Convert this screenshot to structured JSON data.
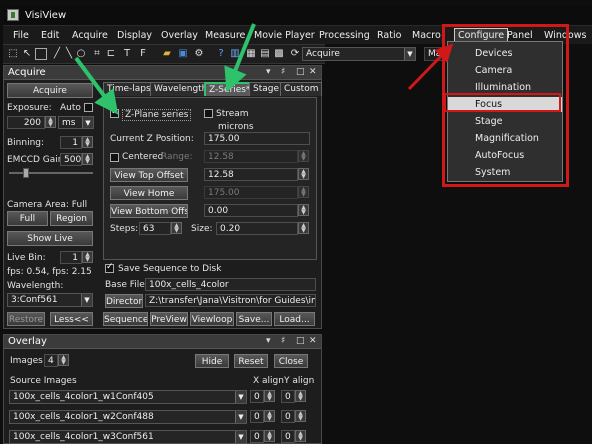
{
  "app": {
    "title": "VisiView"
  },
  "menubar": {
    "items": [
      "File",
      "Edit",
      "Acquire",
      "Display",
      "Overlay",
      "Measure",
      "Movie Player",
      "Processing",
      "Ratio",
      "Macro",
      "Configure",
      "Panel",
      "Windows"
    ]
  },
  "toolbar": {
    "combo_value": "Acquire",
    "combo_right": "Mag"
  },
  "configure_menu": {
    "items": [
      "Devices",
      "Camera",
      "Illumination",
      "Focus",
      "Stage",
      "Magnification",
      "AutoFocus",
      "System"
    ],
    "highlighted": "Focus"
  },
  "acquire_panel": {
    "title": "Acquire",
    "acquire_button": "Acquire",
    "exposure": {
      "label": "Exposure:",
      "auto": "Auto",
      "value": "200",
      "unit": "ms"
    },
    "binning": {
      "label": "Binning:",
      "value": "1"
    },
    "emccd": {
      "label": "EMCCD Gain",
      "value": "500"
    },
    "camera_area": {
      "label": "Camera Area: Full",
      "full": "Full",
      "region": "Region"
    },
    "show_live": "Show Live",
    "live_bin": {
      "label": "Live Bin:",
      "value": "1"
    },
    "fps": "fps: 0.54, fps: 2.15",
    "wavelength": {
      "label": "Wavelength:",
      "value": "3:Conf561"
    },
    "restore": "Restore",
    "less": "Less<<",
    "tabs": [
      "Time-lapse",
      "Wavelength*",
      "Z-Series*",
      "Stage",
      "Custom"
    ],
    "zseries": {
      "zplane_label": "Z-Plane series",
      "zplane_checked": true,
      "stream_label": "Stream",
      "stream_checked": false,
      "microns": "microns",
      "current_z_label": "Current Z Position:",
      "current_z": "175.00",
      "centered_label": "Centered",
      "centered_checked": false,
      "range_label": "Range:",
      "range": "12.58",
      "view_top_offset": "View Top Offset",
      "top_offset": "12.58",
      "view_home": "View Home",
      "home": "175.00",
      "view_bottom_offset": "View Bottom Offset",
      "bottom_offset": "0.00",
      "steps_label": "Steps:",
      "steps": "63",
      "size_label": "Size:",
      "size": "0.20"
    },
    "save_sequence_label": "Save Sequence to Disk",
    "base_file_label": "Base File",
    "base_file": "100x_cells_4color",
    "directory_button": "Directory",
    "directory_path": "Z:\\transfer\\Jana\\Visitron\\for Guides\\images a",
    "actions": [
      "Sequence",
      "PreView",
      "Viewloop",
      "Save...",
      "Load..."
    ]
  },
  "overlay_panel": {
    "title": "Overlay",
    "images_label": "Images",
    "images_value": "4",
    "hide": "Hide",
    "reset": "Reset",
    "close": "Close",
    "source_images_label": "Source Images",
    "x_align_label": "X align",
    "y_align_label": "Y align",
    "rows": [
      {
        "name": "100x_cells_4color1_w1Conf405",
        "x": "0",
        "y": "0"
      },
      {
        "name": "100x_cells_4color1_w2Conf488",
        "x": "0",
        "y": "0"
      },
      {
        "name": "100x_cells_4color1_w3Conf561",
        "x": "0",
        "y": "0"
      }
    ]
  },
  "colors": {
    "accent_green": "#2ec26b",
    "annotation_red": "#d01818",
    "highlight": "#d9d9d9"
  }
}
